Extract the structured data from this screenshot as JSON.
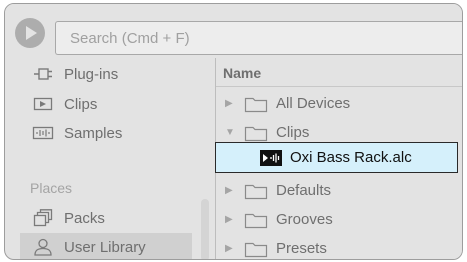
{
  "search": {
    "placeholder": "Search (Cmd + F)"
  },
  "sidebar": {
    "items": [
      {
        "label": "Plug-ins",
        "icon": "plug-in-icon"
      },
      {
        "label": "Clips",
        "icon": "clip-icon"
      },
      {
        "label": "Samples",
        "icon": "sample-icon"
      }
    ],
    "places_label": "Places",
    "places": [
      {
        "label": "Packs",
        "icon": "packs-icon"
      },
      {
        "label": "User Library",
        "icon": "user-icon",
        "selected": true
      }
    ]
  },
  "content": {
    "column_header": "Name",
    "rows": [
      {
        "label": "All Devices",
        "expanded": false
      },
      {
        "label": "Clips",
        "expanded": true
      },
      {
        "label": "Defaults",
        "expanded": false
      },
      {
        "label": "Grooves",
        "expanded": false
      },
      {
        "label": "Presets",
        "expanded": false
      }
    ],
    "selected_file": {
      "label": "Oxi Bass Rack.alc",
      "icon": "clip-file-icon"
    }
  },
  "colors": {
    "selection_fill": "#d5f0fb",
    "selection_border": "#2a2a2a",
    "panel_bg": "#e3e3e3"
  }
}
